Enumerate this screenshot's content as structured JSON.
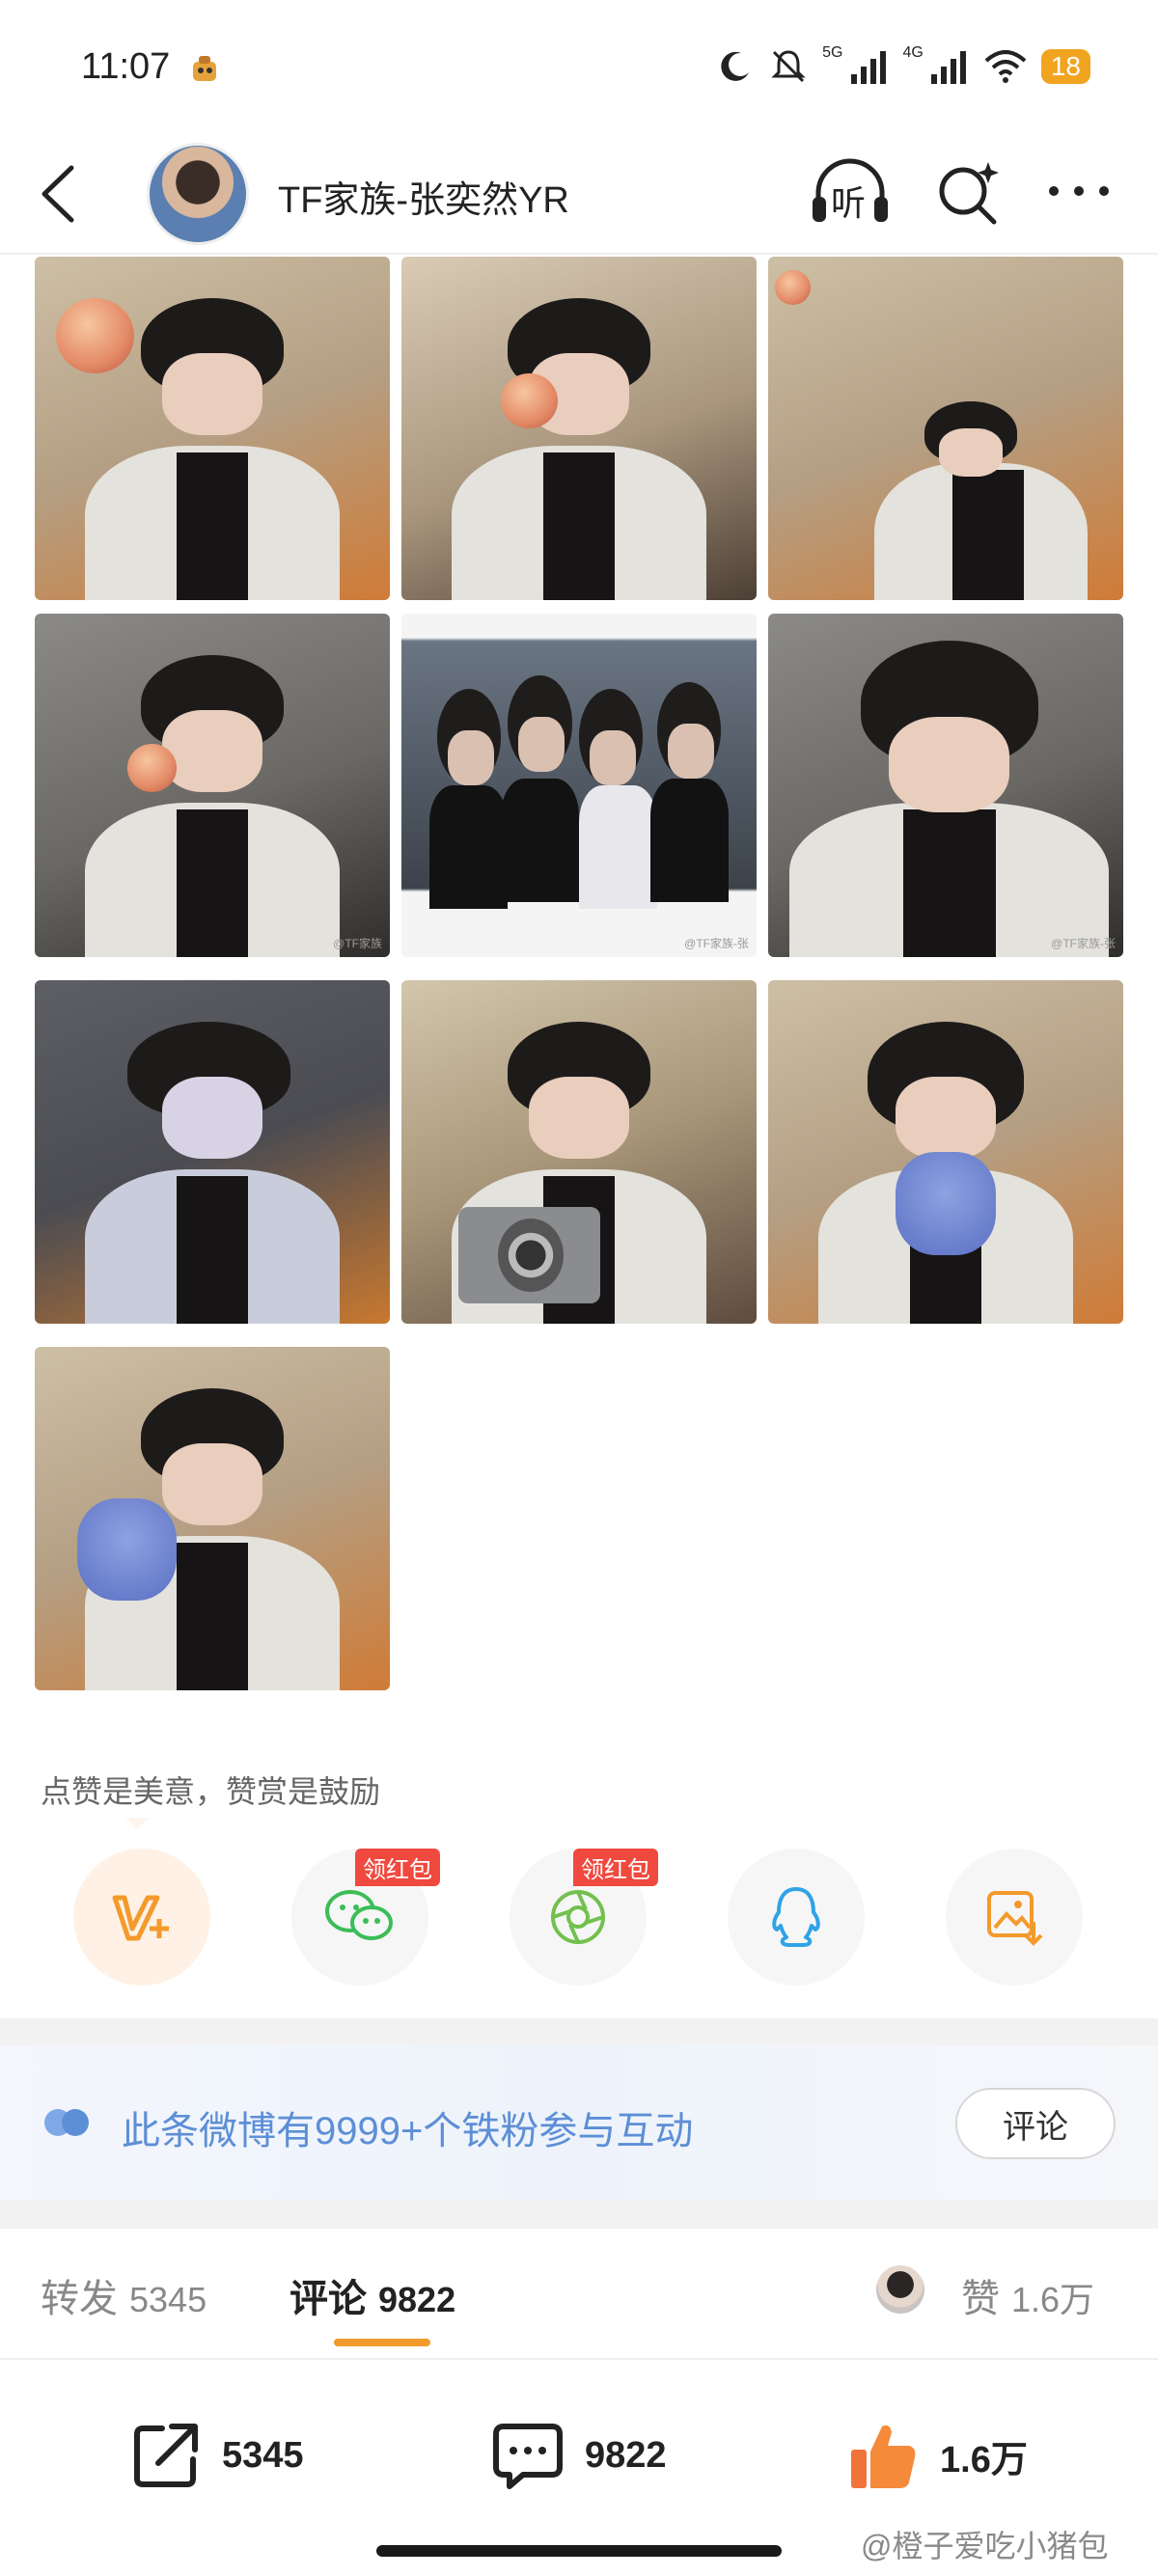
{
  "status_bar": {
    "time": "11:07",
    "signal_1_label": "5G",
    "signal_2_label": "4G",
    "battery": "18"
  },
  "header": {
    "account_name": "TF家族-张奕然YR",
    "listen_label": "听"
  },
  "photos": {
    "watermarks": [
      "@TF家族",
      "@TF家族-张",
      "@TF家族-张"
    ]
  },
  "tip": {
    "text": "点赞是美意，赞赏是鼓励"
  },
  "share": {
    "badge_wechat": "领红包",
    "badge_moments": "领红包"
  },
  "fan_banner": {
    "text": "此条微博有9999+个铁粉参与互动",
    "button": "评论"
  },
  "tabs": {
    "repost_label": "转发",
    "repost_count": "5345",
    "comment_label": "评论",
    "comment_count": "9822",
    "like_label": "赞",
    "like_count": "1.6万"
  },
  "actions": {
    "repost_count": "5345",
    "comment_count": "9822",
    "like_count": "1.6万"
  },
  "footer_watermark": "@橙子爱吃小猪包",
  "colors": {
    "accent_orange": "#f39a2c",
    "link_blue": "#5d8fd6",
    "badge_red": "#f0493f"
  }
}
